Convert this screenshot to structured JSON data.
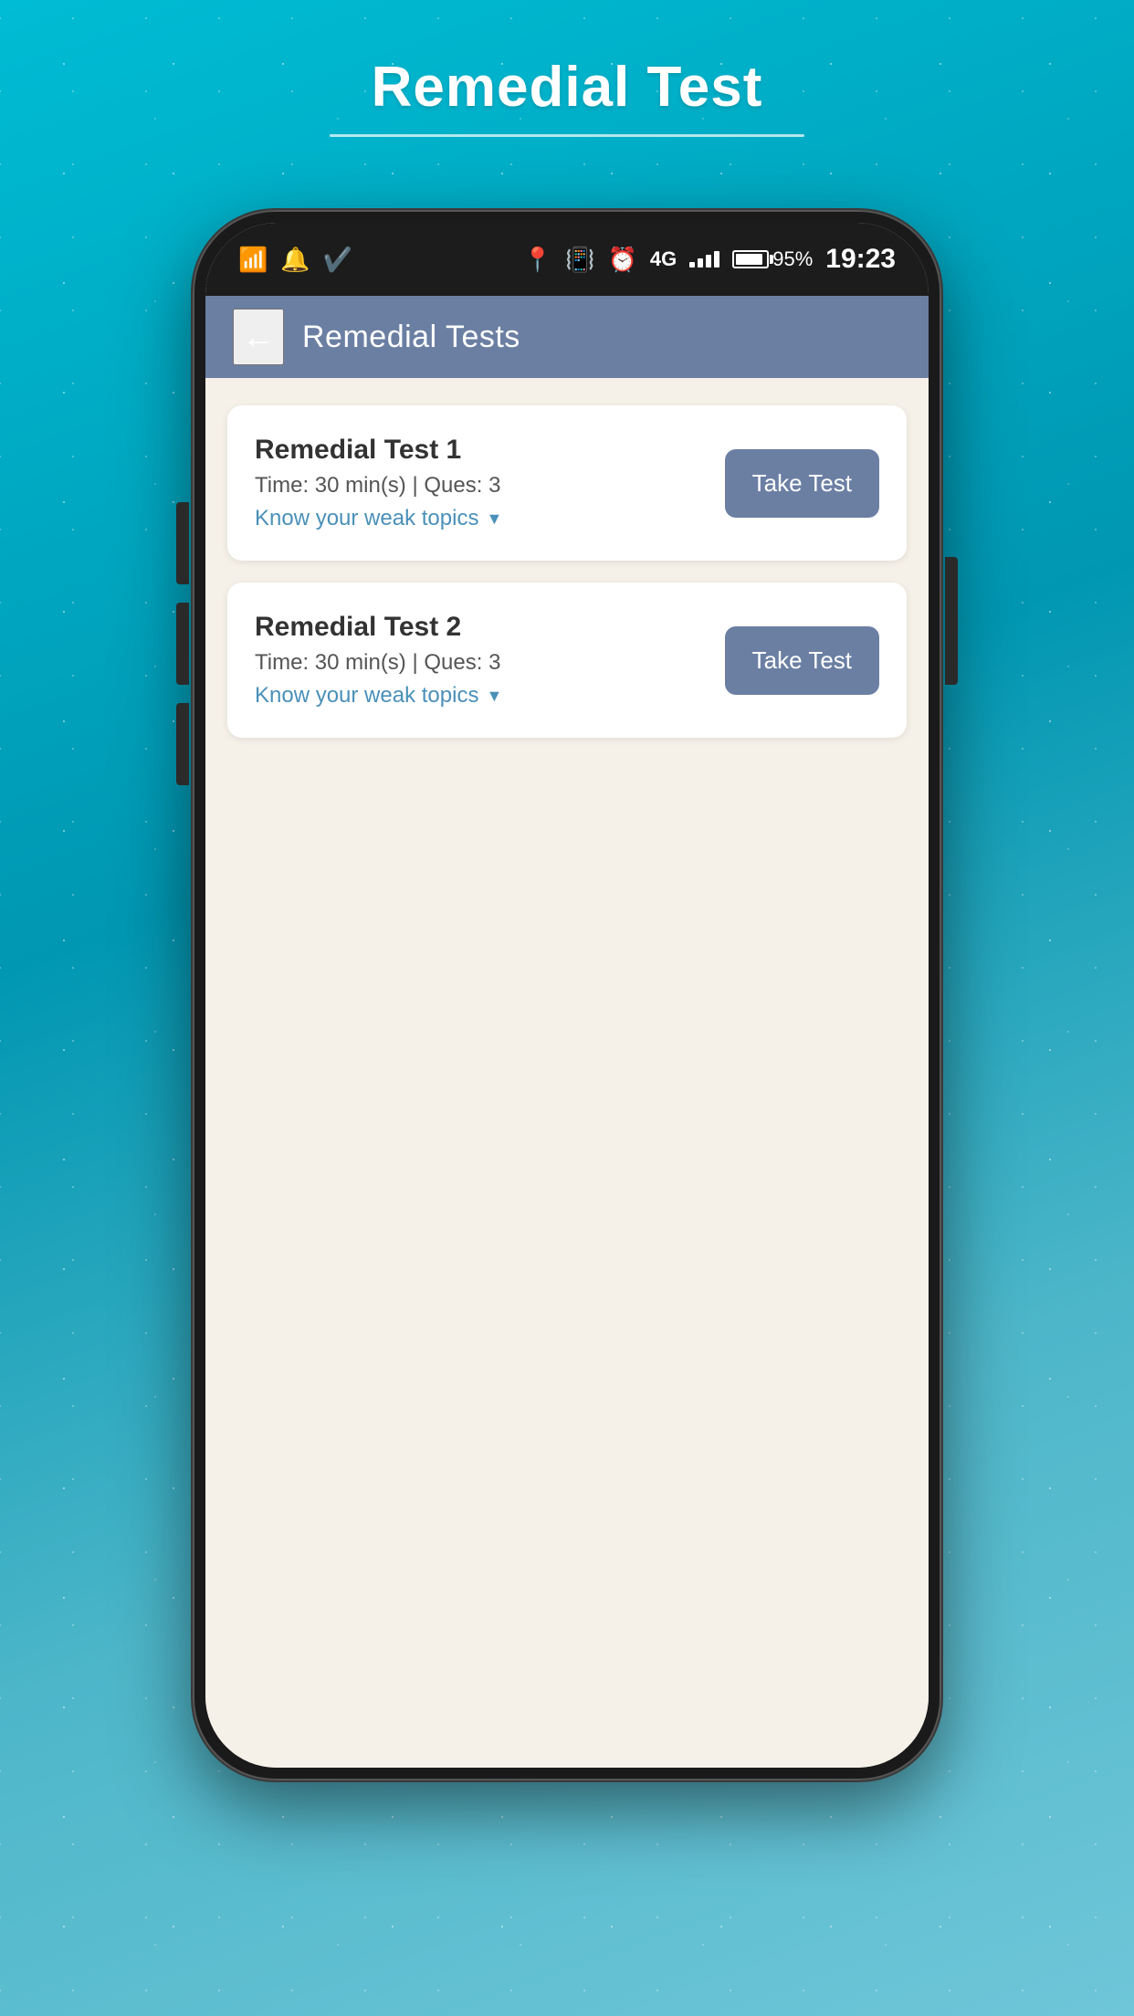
{
  "page": {
    "title": "Remedial Test",
    "title_underline": true,
    "background_color": "#00bcd4"
  },
  "status_bar": {
    "time": "19:23",
    "battery_percent": "95%",
    "network": "4G",
    "icons": [
      "wifi",
      "notification",
      "checkmark",
      "location",
      "vibrate",
      "alarm",
      "signal"
    ]
  },
  "app_header": {
    "back_label": "←",
    "title": "Remedial Tests",
    "background_color": "#6b7fa3"
  },
  "tests": [
    {
      "id": 1,
      "title": "Remedial Test 1",
      "time": "30 min(s)",
      "questions": "3",
      "meta_text": "Time: 30 min(s) | Ques: 3",
      "weak_topics_label": "Know your weak topics",
      "button_label": "Take Test"
    },
    {
      "id": 2,
      "title": "Remedial Test 2",
      "time": "30 min(s)",
      "questions": "3",
      "meta_text": "Time: 30 min(s) | Ques: 3",
      "weak_topics_label": "Know your weak topics",
      "button_label": "Take Test"
    }
  ],
  "colors": {
    "header_bg": "#6b7fa3",
    "button_bg": "#6b7fa3",
    "content_bg": "#f5f0e8",
    "weak_topics_color": "#4a90b8",
    "card_bg": "#ffffff"
  }
}
